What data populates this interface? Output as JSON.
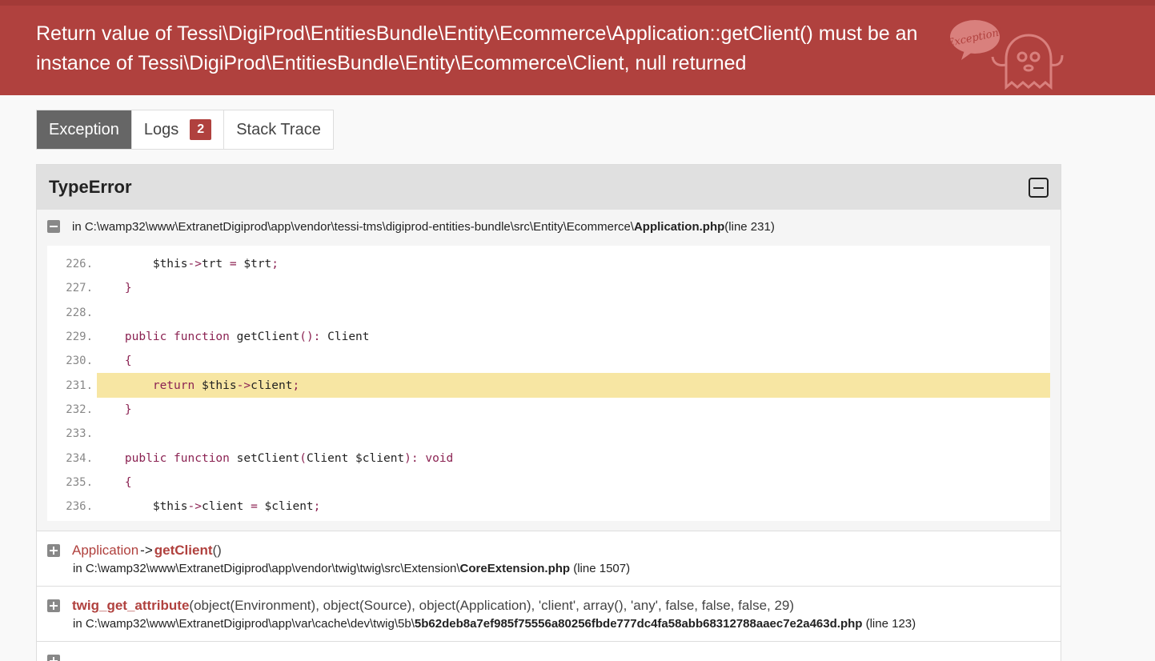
{
  "header": {
    "message": "Return value of Tessi\\DigiProd\\EntitiesBundle\\Entity\\Ecommerce\\Application::getClient() must be an instance of Tessi\\DigiProd\\EntitiesBundle\\Entity\\Ecommerce\\Client, null returned",
    "ghost_text": "Exception!"
  },
  "tabs": [
    {
      "label": "Exception",
      "active": true
    },
    {
      "label": "Logs",
      "badge": "2"
    },
    {
      "label": "Stack Trace"
    }
  ],
  "exception": {
    "class": "TypeError",
    "main_trace": {
      "prefix": "in C:\\wamp32\\www\\ExtranetDigiprod\\app\\vendor\\tessi-tms\\digiprod-entities-bundle\\src\\Entity\\Ecommerce\\",
      "file": "Application.php",
      "suffix": " (line 231)"
    },
    "code_lines": [
      {
        "no": "226.",
        "code": "        $this->trt = $trt;"
      },
      {
        "no": "227.",
        "code": "    }"
      },
      {
        "no": "228.",
        "code": ""
      },
      {
        "no": "229.",
        "code": "    public function getClient(): Client"
      },
      {
        "no": "230.",
        "code": "    {"
      },
      {
        "no": "231.",
        "code": "        return $this->client;",
        "highlight": true
      },
      {
        "no": "232.",
        "code": "    }"
      },
      {
        "no": "233.",
        "code": ""
      },
      {
        "no": "234.",
        "code": "    public function setClient(Client $client): void"
      },
      {
        "no": "235.",
        "code": "    {"
      },
      {
        "no": "236.",
        "code": "        $this->client = $client;"
      }
    ],
    "traces": [
      {
        "class": "Application",
        "arrow": "->",
        "method": "getClient",
        "args": "()",
        "prefix": "in C:\\wamp32\\www\\ExtranetDigiprod\\app\\vendor\\twig\\twig\\src\\Extension\\",
        "file": "CoreExtension.php",
        "suffix": " (line 1507)"
      },
      {
        "method": "twig_get_attribute",
        "args": "(object(Environment), object(Source), object(Application), 'client', array(), 'any', false, false, false, 29)",
        "prefix": "in C:\\wamp32\\www\\ExtranetDigiprod\\app\\var\\cache\\dev\\twig\\5b\\",
        "file": "5b62deb8a7ef985f75556a80256fbde777dc4fa58abb68312788aaec7e2a463d.php",
        "suffix": " (line 123)"
      }
    ]
  }
}
